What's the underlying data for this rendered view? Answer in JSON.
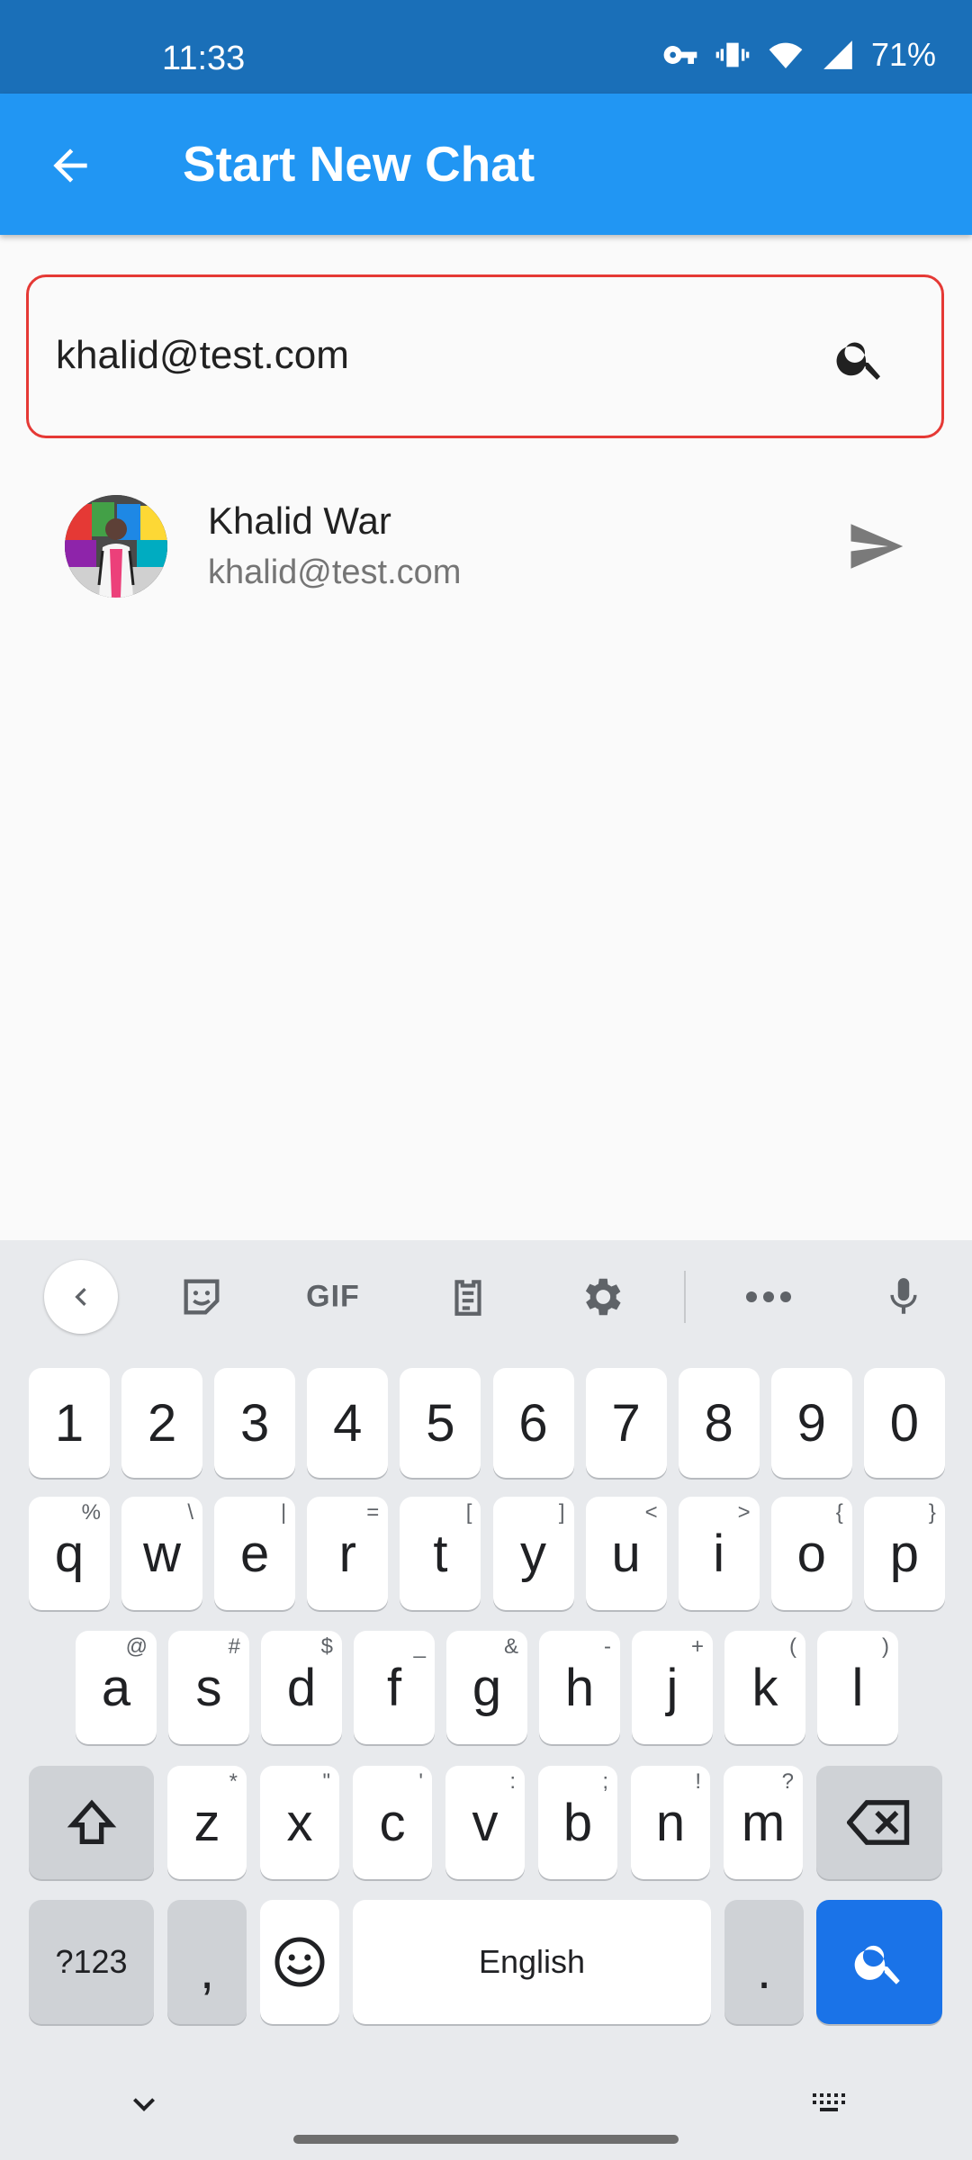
{
  "status_bar": {
    "time": "11:33",
    "battery": "71%"
  },
  "app_bar": {
    "title": "Start New Chat"
  },
  "search": {
    "value": "khalid@test.com"
  },
  "results": [
    {
      "name": "Khalid War",
      "email": "khalid@test.com"
    }
  ],
  "keyboard": {
    "toolbar": {
      "gif_label": "GIF"
    },
    "number_row": [
      "1",
      "2",
      "3",
      "4",
      "5",
      "6",
      "7",
      "8",
      "9",
      "0"
    ],
    "row1": [
      {
        "k": "q",
        "s": "%"
      },
      {
        "k": "w",
        "s": "\\"
      },
      {
        "k": "e",
        "s": "|"
      },
      {
        "k": "r",
        "s": "="
      },
      {
        "k": "t",
        "s": "["
      },
      {
        "k": "y",
        "s": "]"
      },
      {
        "k": "u",
        "s": "<"
      },
      {
        "k": "i",
        "s": ">"
      },
      {
        "k": "o",
        "s": "{"
      },
      {
        "k": "p",
        "s": "}"
      }
    ],
    "row2": [
      {
        "k": "a",
        "s": "@"
      },
      {
        "k": "s",
        "s": "#"
      },
      {
        "k": "d",
        "s": "$"
      },
      {
        "k": "f",
        "s": "_"
      },
      {
        "k": "g",
        "s": "&"
      },
      {
        "k": "h",
        "s": "-"
      },
      {
        "k": "j",
        "s": "+"
      },
      {
        "k": "k",
        "s": "("
      },
      {
        "k": "l",
        "s": ")"
      }
    ],
    "row3": [
      {
        "k": "z",
        "s": "*"
      },
      {
        "k": "x",
        "s": "\""
      },
      {
        "k": "c",
        "s": "'"
      },
      {
        "k": "v",
        "s": ":"
      },
      {
        "k": "b",
        "s": ";"
      },
      {
        "k": "n",
        "s": "!"
      },
      {
        "k": "m",
        "s": "?"
      }
    ],
    "symbols_label": "?123",
    "comma": ",",
    "space_label": "English",
    "period": "."
  }
}
